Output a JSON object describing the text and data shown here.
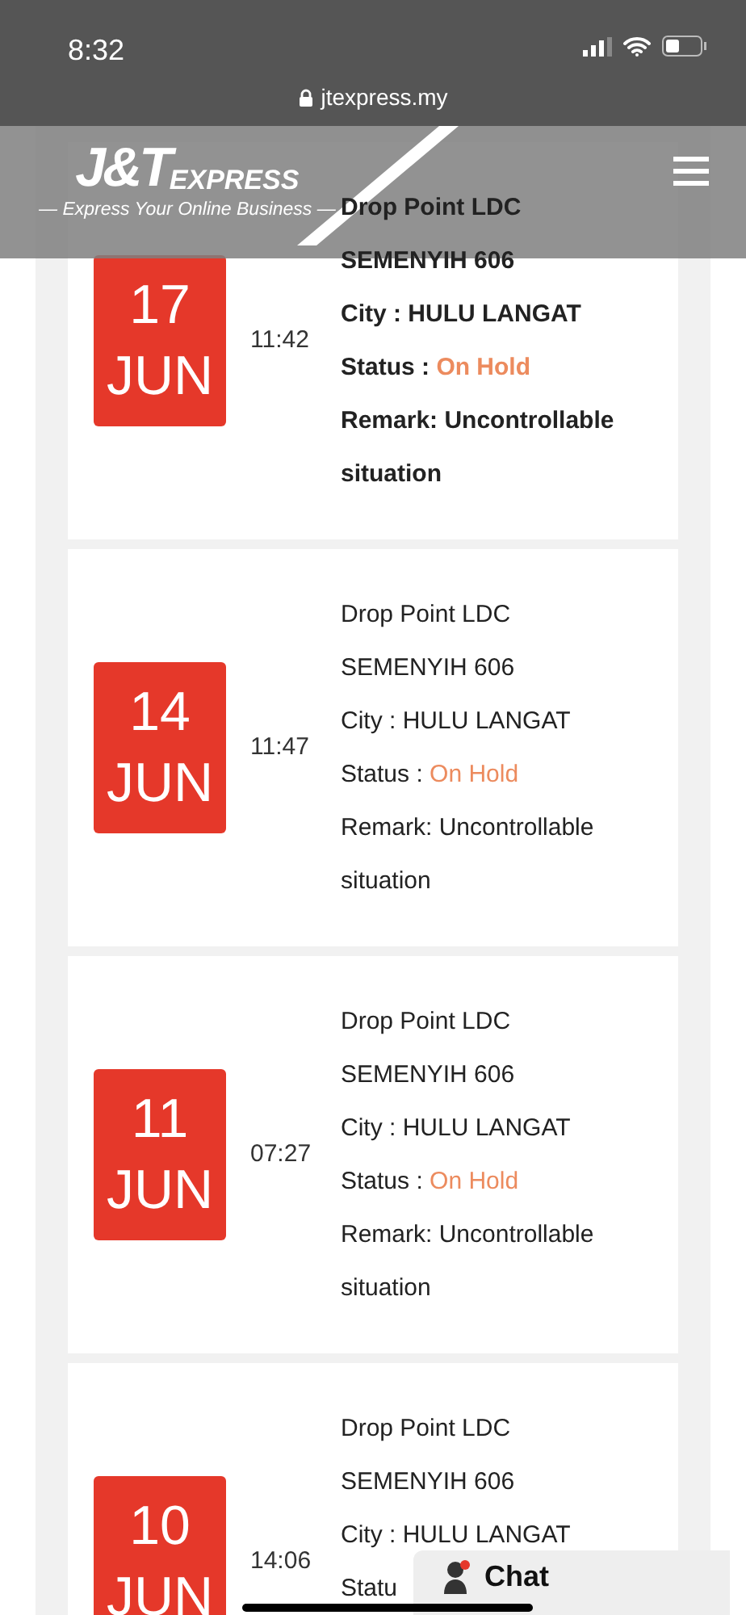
{
  "status_bar": {
    "time": "8:32",
    "url": "jtexpress.my"
  },
  "header": {
    "logo_mark": "J&T",
    "logo_word": "EXPRESS",
    "tagline": "— Express Your Online Business —"
  },
  "events": [
    {
      "day": "17",
      "month": "JUN",
      "time": "11:42",
      "latest": true,
      "lines": [
        "Drop Point LDC",
        "SEMENYIH 606",
        "City : HULU LANGAT"
      ],
      "status_label": "Status : ",
      "status_value": "On Hold",
      "remark": [
        "Remark: Uncontrollable",
        "situation"
      ]
    },
    {
      "day": "14",
      "month": "JUN",
      "time": "11:47",
      "latest": false,
      "lines": [
        "Drop Point LDC",
        "SEMENYIH 606",
        "City : HULU LANGAT"
      ],
      "status_label": "Status : ",
      "status_value": "On Hold",
      "remark": [
        "Remark: Uncontrollable",
        "situation"
      ]
    },
    {
      "day": "11",
      "month": "JUN",
      "time": "07:27",
      "latest": false,
      "lines": [
        "Drop Point LDC",
        "SEMENYIH 606",
        "City : HULU LANGAT"
      ],
      "status_label": "Status : ",
      "status_value": "On Hold",
      "remark": [
        "Remark: Uncontrollable",
        "situation"
      ]
    },
    {
      "day": "10",
      "month": "JUN",
      "time": "14:06",
      "latest": false,
      "lines": [
        "Drop Point LDC",
        "SEMENYIH 606",
        "City : HULU LANGAT"
      ],
      "status_label": "Statu"
    }
  ],
  "chat_button": {
    "label": "Chat"
  }
}
